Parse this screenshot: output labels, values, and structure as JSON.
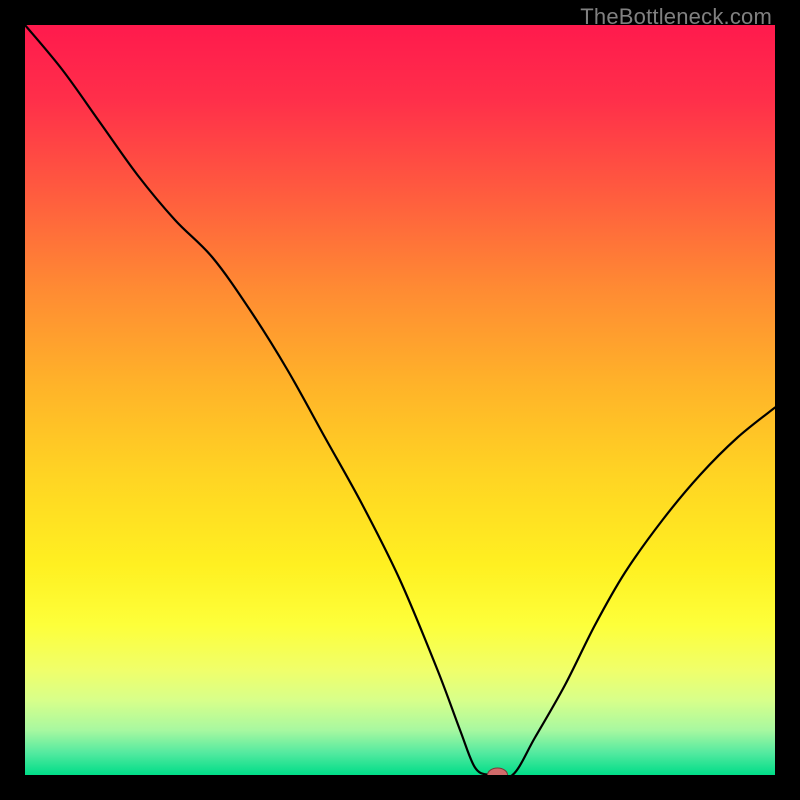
{
  "watermark": "TheBottleneck.com",
  "chart_data": {
    "type": "line",
    "title": "",
    "xlabel": "",
    "ylabel": "",
    "xlim": [
      0,
      100
    ],
    "ylim": [
      0,
      100
    ],
    "x": [
      0,
      5,
      10,
      15,
      20,
      25,
      30,
      35,
      40,
      45,
      50,
      55,
      58,
      60,
      62,
      65,
      68,
      72,
      76,
      80,
      85,
      90,
      95,
      100
    ],
    "values": [
      100,
      94,
      87,
      80,
      74,
      69,
      62,
      54,
      45,
      36,
      26,
      14,
      6,
      1,
      0,
      0,
      5,
      12,
      20,
      27,
      34,
      40,
      45,
      49
    ],
    "marker": {
      "x": 63,
      "y": 0,
      "color": "#d06a6a"
    },
    "gradient_stops": [
      {
        "offset": 0.0,
        "color": "#ff1a4d"
      },
      {
        "offset": 0.1,
        "color": "#ff2f4a"
      },
      {
        "offset": 0.22,
        "color": "#ff5a3f"
      },
      {
        "offset": 0.35,
        "color": "#ff8a33"
      },
      {
        "offset": 0.48,
        "color": "#ffb329"
      },
      {
        "offset": 0.6,
        "color": "#ffd423"
      },
      {
        "offset": 0.72,
        "color": "#fff021"
      },
      {
        "offset": 0.8,
        "color": "#fdff3a"
      },
      {
        "offset": 0.86,
        "color": "#f0ff6a"
      },
      {
        "offset": 0.9,
        "color": "#d8ff8a"
      },
      {
        "offset": 0.94,
        "color": "#a8f8a0"
      },
      {
        "offset": 0.97,
        "color": "#55eaa0"
      },
      {
        "offset": 1.0,
        "color": "#00dd88"
      }
    ]
  }
}
